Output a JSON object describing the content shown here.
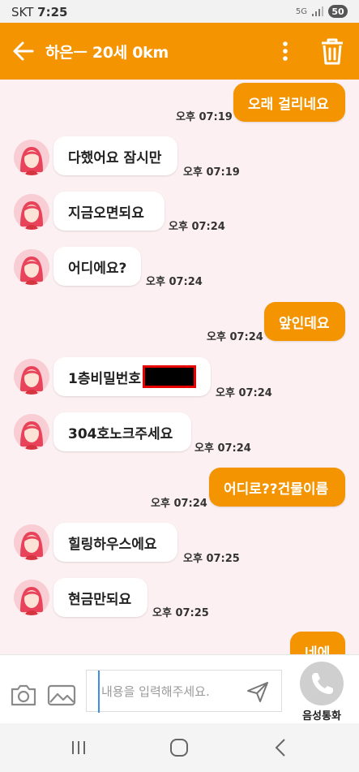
{
  "status_bar": {
    "carrier": "SKT",
    "time": "7:25",
    "network": "5G",
    "battery": "50"
  },
  "header": {
    "title": "하은ㅡ 20세 0km"
  },
  "messages": [
    {
      "dir": "out",
      "text": "오래 걸리네요",
      "time": "오후 07:19"
    },
    {
      "dir": "in",
      "text": "다했어요 잠시만",
      "time": "오후 07:19"
    },
    {
      "dir": "in",
      "text": "지금오면되요",
      "time": "오후 07:24"
    },
    {
      "dir": "in",
      "text": "어디에요?",
      "time": "오후 07:24"
    },
    {
      "dir": "out",
      "text": "앞인데요",
      "time": "오후 07:24"
    },
    {
      "dir": "in",
      "text": "1층비밀번호",
      "time": "오후 07:24",
      "redacted": true
    },
    {
      "dir": "in",
      "text": "304호노크주세요",
      "time": "오후 07:24"
    },
    {
      "dir": "out",
      "text": "어디로??건물이름",
      "time": "오후 07:24"
    },
    {
      "dir": "in",
      "text": "힐링하우스에요",
      "time": "오후 07:25"
    },
    {
      "dir": "in",
      "text": "현금만되요",
      "time": "오후 07:25"
    },
    {
      "dir": "out",
      "text": "네에",
      "time": ""
    }
  ],
  "input": {
    "placeholder": "내용을 입력해주세요."
  },
  "call": {
    "label": "음성통화"
  },
  "colors": {
    "accent": "#F39400",
    "chat_bg": "#FCF0F2"
  },
  "icons": [
    "back-arrow-icon",
    "more-vert-icon",
    "trash-icon",
    "camera-icon",
    "image-icon",
    "send-icon",
    "phone-icon",
    "recent-apps-icon",
    "home-icon",
    "back-nav-icon"
  ]
}
